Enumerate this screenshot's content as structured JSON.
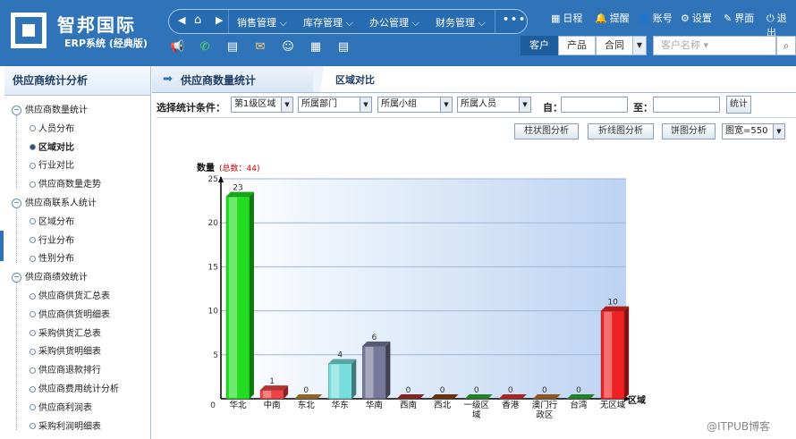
{
  "brand": {
    "name": "智邦国际",
    "subtitle": "ERP系统 (经典版)"
  },
  "nav": {
    "menus": [
      "销售管理",
      "库存管理",
      "办公管理",
      "财务管理"
    ],
    "more": "•••"
  },
  "top_links": [
    {
      "icon": "calendar-icon",
      "glyph": "▦",
      "label": "日程"
    },
    {
      "icon": "bell-icon",
      "glyph": "🔔",
      "label": "提醒"
    },
    {
      "icon": "user-icon",
      "glyph": "👤",
      "label": "账号"
    },
    {
      "icon": "gear-icon",
      "glyph": "⚙",
      "label": "设置"
    },
    {
      "icon": "edit-icon",
      "glyph": "✎",
      "label": "界面"
    },
    {
      "icon": "power-icon",
      "glyph": "⏻",
      "label": "退出"
    }
  ],
  "quick_icons": [
    "megaphone-icon",
    "phone-icon",
    "printer-icon",
    "mail-icon",
    "wechat-icon",
    "grid-icon",
    "document-icon"
  ],
  "segments": [
    "客户",
    "产品",
    "合同"
  ],
  "search": {
    "placeholder": "客户名称"
  },
  "sidebar": {
    "title": "供应商统计分析",
    "groups": [
      {
        "label": "供应商数量统计",
        "items": [
          "人员分布",
          "区域对比",
          "行业对比",
          "供应商数量走势"
        ],
        "selected": "区域对比"
      },
      {
        "label": "供应商联系人统计",
        "items": [
          "区域分布",
          "行业分布",
          "性别分布"
        ]
      },
      {
        "label": "供应商绩效统计",
        "items": [
          "供应商供货汇总表",
          "供应商供货明细表",
          "采购供货汇总表",
          "采购供货明细表",
          "供应商退款排行",
          "供应商费用统计分析",
          "供应商利润表",
          "采购利润明细表"
        ]
      }
    ]
  },
  "page": {
    "title": "供应商数量统计",
    "subtab": "区域对比"
  },
  "filters": {
    "label": "选择统计条件：",
    "selects": [
      "第1级区域",
      "所属部门",
      "所属小组",
      "所属人员"
    ],
    "from_label": "自：",
    "to_label": "至：",
    "submit": "统计"
  },
  "analysis_buttons": [
    "柱状图分析",
    "折线图分析",
    "饼图分析"
  ],
  "width_select": "图宽=550",
  "chart_data": {
    "type": "bar",
    "ylabel": "数量",
    "total_label": "(总数：44)",
    "xlabel": "区域",
    "ylim": [
      0,
      25
    ],
    "yticks": [
      0,
      5,
      10,
      15,
      20,
      25
    ],
    "categories": [
      "华北",
      "中南",
      "东北",
      "华东",
      "华南",
      "西南",
      "西北",
      "一级区域",
      "香港",
      "澳门行政区",
      "台湾",
      "无区域"
    ],
    "category_lines": [
      [
        "华北"
      ],
      [
        "中南"
      ],
      [
        "东北"
      ],
      [
        "华东"
      ],
      [
        "华南"
      ],
      [
        "西南"
      ],
      [
        "西北"
      ],
      [
        "一级区",
        "域"
      ],
      [
        "香港"
      ],
      [
        "澳门行",
        "政区"
      ],
      [
        "台湾"
      ],
      [
        "无区域"
      ]
    ],
    "values": [
      23,
      1,
      0,
      4,
      6,
      0,
      0,
      0,
      0,
      0,
      0,
      10
    ],
    "colors": [
      "#22dd22",
      "#ee4444",
      "#bb8833",
      "#77dddd",
      "#777799",
      "#aa3333",
      "#8b4513",
      "#33aa33",
      "#dd3333",
      "#bb7733",
      "#33aa33",
      "#ee2222"
    ]
  },
  "watermark": "@ITPUB博客"
}
